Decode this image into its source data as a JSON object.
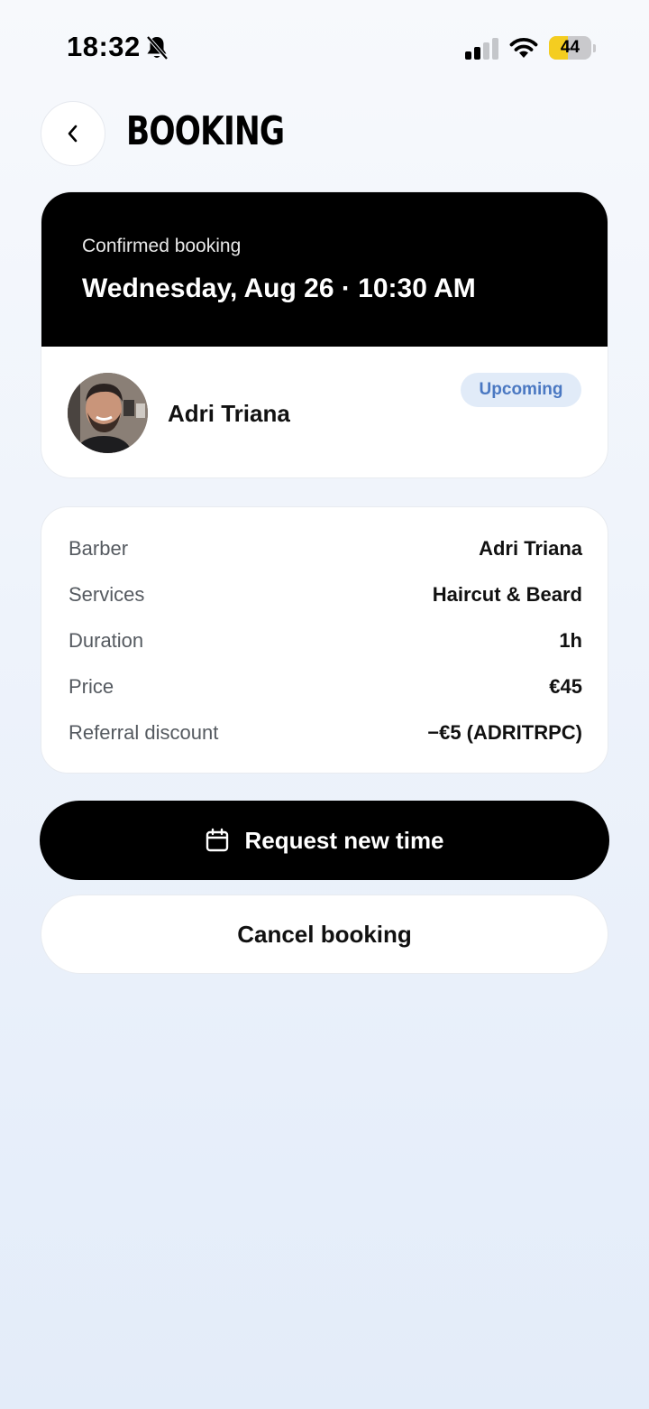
{
  "status_bar": {
    "time": "18:32",
    "battery_level": "44",
    "battery_fraction": 0.44,
    "icons": [
      "bell-slash-icon",
      "signal-icon",
      "wifi-icon",
      "battery-icon"
    ]
  },
  "header": {
    "back_icon": "chevron-left-icon",
    "title": "BOOKING"
  },
  "booking": {
    "status": "Confirmed booking",
    "datetime": "Wednesday, Aug 26 · 10:30 AM",
    "barber_name": "Adri Triana",
    "badge": "Upcoming"
  },
  "details": [
    {
      "label": "Barber",
      "value": "Adri Triana"
    },
    {
      "label": "Services",
      "value": "Haircut & Beard"
    },
    {
      "label": "Duration",
      "value": "1h"
    },
    {
      "label": "Price",
      "value": "€45"
    },
    {
      "label": "Referral discount",
      "value": "−€5 (ADRITRPC)"
    }
  ],
  "actions": {
    "request_icon": "calendar-icon",
    "request_label": "Request new time",
    "cancel_label": "Cancel booking"
  },
  "colors": {
    "primary": "#000000",
    "badge_bg": "#e1ebf8",
    "badge_text": "#4a78c2",
    "battery": "#f4cd20"
  }
}
